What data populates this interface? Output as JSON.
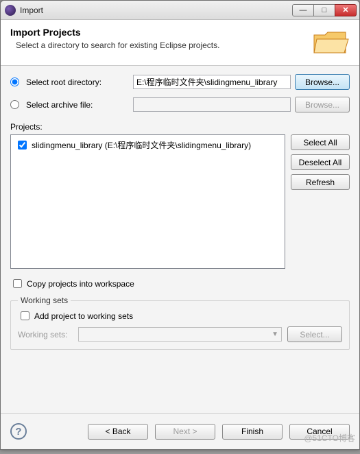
{
  "window": {
    "title": "Import"
  },
  "header": {
    "title": "Import Projects",
    "subtitle": "Select a directory to search for existing Eclipse projects."
  },
  "source": {
    "root_label": "Select root directory:",
    "root_value": "E:\\程序临时文件夹\\slidingmenu_library",
    "archive_label": "Select archive file:",
    "archive_value": "",
    "browse_label": "Browse..."
  },
  "projects": {
    "label": "Projects:",
    "items": [
      {
        "checked": true,
        "label": "slidingmenu_library (E:\\程序临时文件夹\\slidingmenu_library)"
      }
    ],
    "select_all": "Select All",
    "deselect_all": "Deselect All",
    "refresh": "Refresh"
  },
  "options": {
    "copy_label": "Copy projects into workspace",
    "copy_checked": false
  },
  "working_sets": {
    "legend": "Working sets",
    "add_label": "Add project to working sets",
    "add_checked": false,
    "combo_label": "Working sets:",
    "select_label": "Select..."
  },
  "footer": {
    "back": "< Back",
    "next": "Next >",
    "finish": "Finish",
    "cancel": "Cancel"
  },
  "watermark": "@51CTO博客"
}
